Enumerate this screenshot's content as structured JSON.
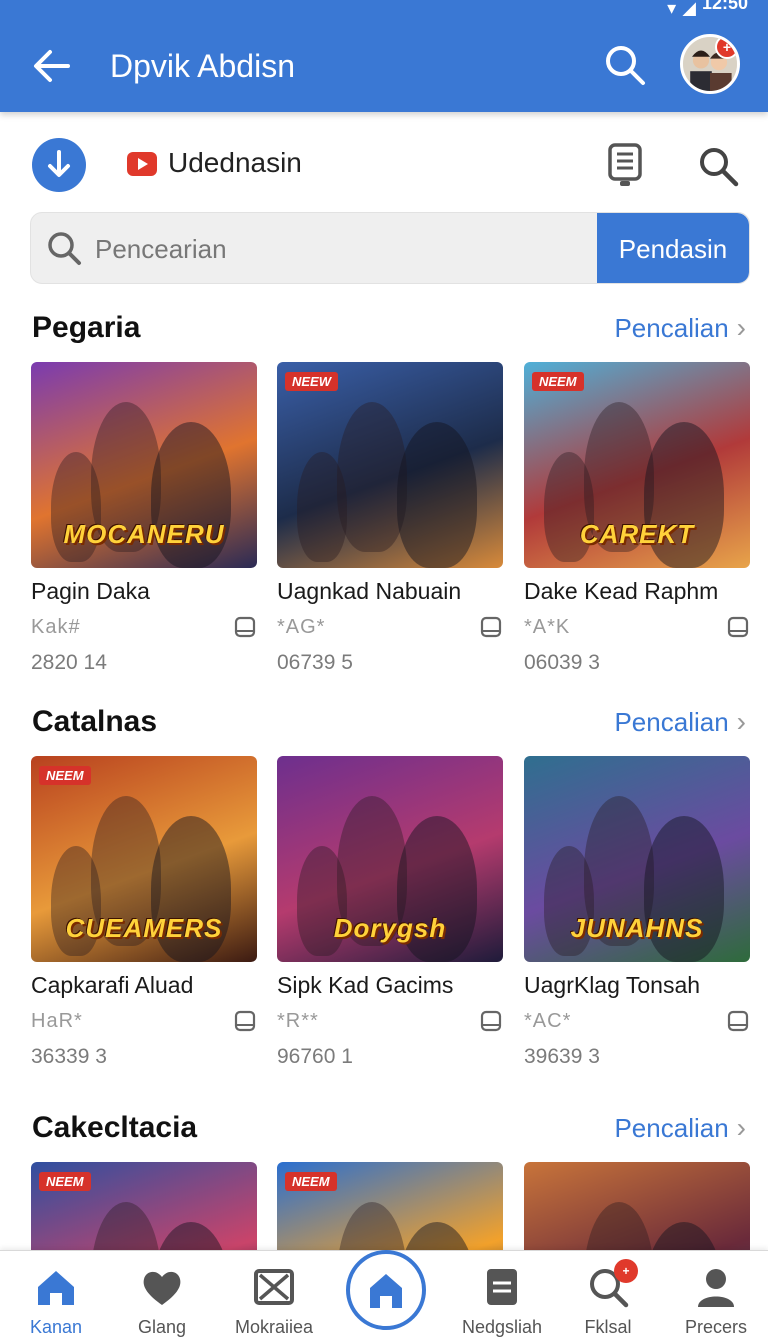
{
  "status_bar": {
    "time": "12:50"
  },
  "app_bar": {
    "title": "Dpvik Abdisn",
    "avatar_badge": "+"
  },
  "toolbar": {
    "label": "Udednasin"
  },
  "search": {
    "placeholder": "Pencearian",
    "button_label": "Pendasin"
  },
  "sections": [
    {
      "title": "Pegaria",
      "see_all": "Pencalian",
      "cards": [
        {
          "name": "Pagin Daka",
          "rating": "Kak#",
          "count": "2820 14",
          "art_text": "MOCANERU",
          "new": "",
          "colors": [
            "#7a3bb0",
            "#e0742f",
            "#2a2a55"
          ]
        },
        {
          "name": "Uagnkad Nabuain",
          "rating": "*AG*",
          "count": "06739 5",
          "art_text": "",
          "new": "NEEW",
          "colors": [
            "#3a5fa8",
            "#1d2c4a",
            "#d88a3a"
          ]
        },
        {
          "name": "Dake Kead Raphm",
          "rating": "*A*K",
          "count": "06039 3",
          "art_text": "CAREKT",
          "new": "NEEM",
          "colors": [
            "#4fb0d8",
            "#b13a3a",
            "#e8a44a"
          ]
        }
      ]
    },
    {
      "title": "Catalnas",
      "see_all": "Pencalian",
      "cards": [
        {
          "name": "Capkarafi Aluad",
          "rating": "HaR*",
          "count": "36339 3",
          "art_text": "CUEAMERS",
          "new": "NEEM",
          "colors": [
            "#b8411f",
            "#e89a3a",
            "#3b1a12"
          ]
        },
        {
          "name": "Sipk Kad Gacims",
          "rating": "*R**",
          "count": "96760 1",
          "art_text": "Dorygsh",
          "new": "",
          "colors": [
            "#6d2f8e",
            "#b53b6e",
            "#1e1b3a"
          ]
        },
        {
          "name": "UagrKlag Tonsah",
          "rating": "*AC*",
          "count": "39639 3",
          "art_text": "JUNAHNS",
          "new": "",
          "colors": [
            "#2f6f8f",
            "#6b4ba0",
            "#2e6b3b"
          ]
        }
      ]
    },
    {
      "title": "Cakecltacia",
      "see_all": "Pencalian",
      "cards": [
        {
          "name": "",
          "rating": "",
          "count": "",
          "art_text": "",
          "new": "NEEM",
          "colors": [
            "#2f4fa0",
            "#c9446a",
            "#1b2440"
          ]
        },
        {
          "name": "",
          "rating": "",
          "count": "",
          "art_text": "",
          "new": "NEEM",
          "colors": [
            "#2a6fd0",
            "#f2a12b",
            "#1b2a55"
          ]
        },
        {
          "name": "",
          "rating": "",
          "count": "",
          "art_text": "",
          "new": "",
          "colors": [
            "#c8743a",
            "#6a2a3a",
            "#3a4e70"
          ]
        }
      ]
    }
  ],
  "bottom_nav": [
    {
      "label": "Kanan",
      "icon": "home-icon",
      "active": true
    },
    {
      "label": "Glang",
      "icon": "heart-icon"
    },
    {
      "label": "Mokraiiea",
      "icon": "image-icon"
    },
    {
      "label": "",
      "icon": "home-center-icon"
    },
    {
      "label": "Nedgsliah",
      "icon": "document-icon"
    },
    {
      "label": "Fklsal",
      "icon": "search-icon",
      "badge": "+"
    },
    {
      "label": "Precers",
      "icon": "person-icon"
    }
  ],
  "colors": {
    "primary": "#3a78d4",
    "badge": "#e0392b",
    "text_secondary": "#7b7b7b"
  }
}
